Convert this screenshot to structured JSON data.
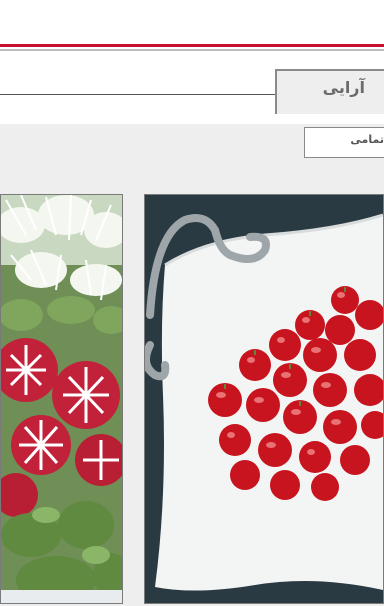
{
  "header": {
    "title": "آرایی",
    "subtitle": "تمامی"
  },
  "colors": {
    "accent_red": "#c8102e",
    "rule_gray": "#bdbdbd",
    "panel_bg": "#eeeeee",
    "title_text": "#6b6b6b"
  },
  "images": [
    {
      "name": "radish-flower-garnish"
    },
    {
      "name": "cherry-tomato-plate"
    }
  ]
}
